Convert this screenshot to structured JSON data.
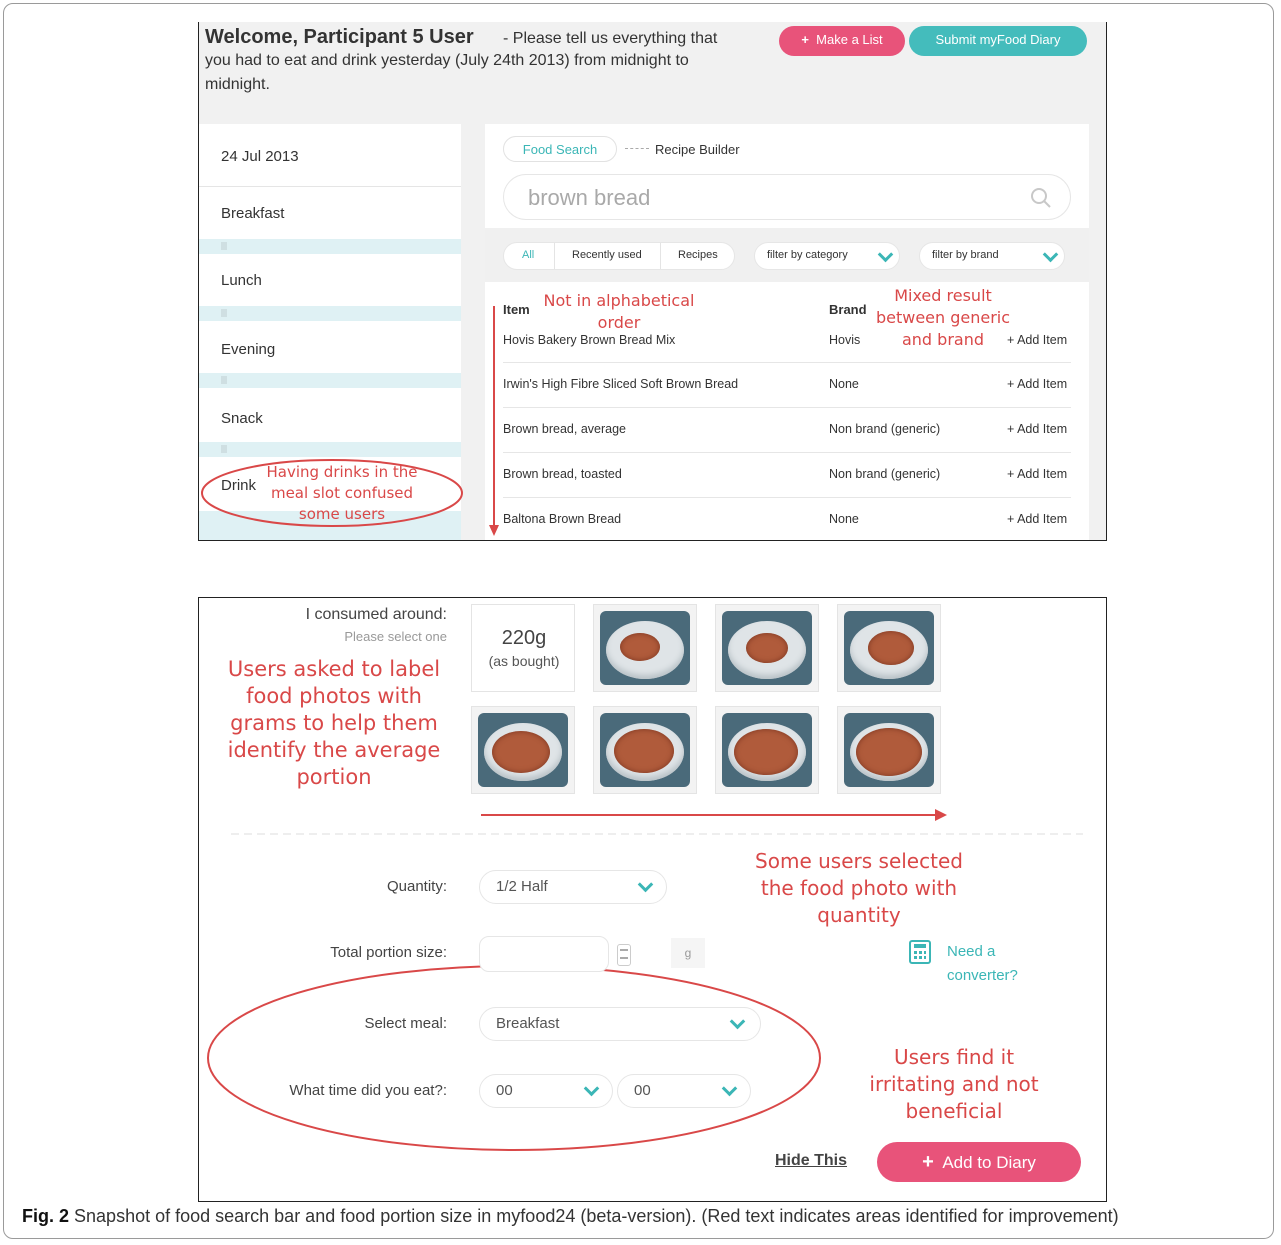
{
  "header": {
    "welcome_title": "Welcome, Participant 5 User",
    "welcome_text_1": "- Please tell us everything that",
    "welcome_text_2": "you had to eat and drink yesterday (July 24th 2013) from midnight to",
    "welcome_text_3": "midnight.",
    "make_list_label": "Make a List",
    "submit_label": "Submit myFood Diary"
  },
  "sidebar": {
    "date": "24 Jul 2013",
    "meals": [
      "Breakfast",
      "Lunch",
      "Evening",
      "Snack",
      "Drink"
    ]
  },
  "search": {
    "tab_food_search": "Food Search",
    "tab_recipe_builder": "Recipe Builder",
    "query": "brown bread",
    "filter_all": "All",
    "filter_recent": "Recently used",
    "filter_recipes": "Recipes",
    "filter_category": "filter by category",
    "filter_brand": "filter by brand",
    "col_item": "Item",
    "col_brand": "Brand",
    "rows": [
      {
        "item": "Hovis Bakery Brown Bread Mix",
        "brand": "Hovis",
        "action": "+ Add Item"
      },
      {
        "item": "Irwin's High Fibre Sliced Soft Brown Bread",
        "brand": "None",
        "action": "+ Add Item"
      },
      {
        "item": "Brown bread, average",
        "brand": "Non brand (generic)",
        "action": "+ Add Item"
      },
      {
        "item": "Brown bread, toasted",
        "brand": "Non brand (generic)",
        "action": "+ Add Item"
      },
      {
        "item": "Baltona Brown Bread",
        "brand": "None",
        "action": "+ Add Item"
      }
    ]
  },
  "annotations1": {
    "alpha_1": "Not in alphabetical",
    "alpha_2": "order",
    "mixed_1": "Mixed result",
    "mixed_2": "between generic",
    "mixed_3": "and brand",
    "drinks_1": "Having drinks in the",
    "drinks_2": "meal slot confused",
    "drinks_3": "some users"
  },
  "portion": {
    "consumed_label": "I consumed around:",
    "select_one": "Please select one",
    "weight": "220g",
    "weight_note": "(as bought)",
    "quantity_label": "Quantity:",
    "quantity_value": "1/2 Half",
    "total_label": "Total portion size:",
    "unit": "g",
    "converter_1": "Need a",
    "converter_2": "converter?",
    "meal_label": "Select meal:",
    "meal_value": "Breakfast",
    "time_label": "What time did you eat?:",
    "hour_value": "00",
    "minute_value": "00",
    "hide_label": "Hide This",
    "add_label": "Add to Diary"
  },
  "annotations2": {
    "label_1": "Users asked to label",
    "label_2": "food photos with",
    "label_3": "grams to help them",
    "label_4": "identify the average",
    "label_5": "portion",
    "qty_1": "Some users selected",
    "qty_2": "the food photo with",
    "qty_3": "quantity",
    "irr_1": "Users find it",
    "irr_2": "irritating and not",
    "irr_3": "beneficial"
  },
  "caption": {
    "fig": "Fig. 2",
    "text": "Snapshot of food search bar and food portion size in myfood24 (beta-version). (Red text indicates areas identified for improvement)"
  },
  "colors": {
    "accent_pink": "#e8537a",
    "accent_teal": "#44bcbc",
    "annotation_red": "#d94848"
  }
}
